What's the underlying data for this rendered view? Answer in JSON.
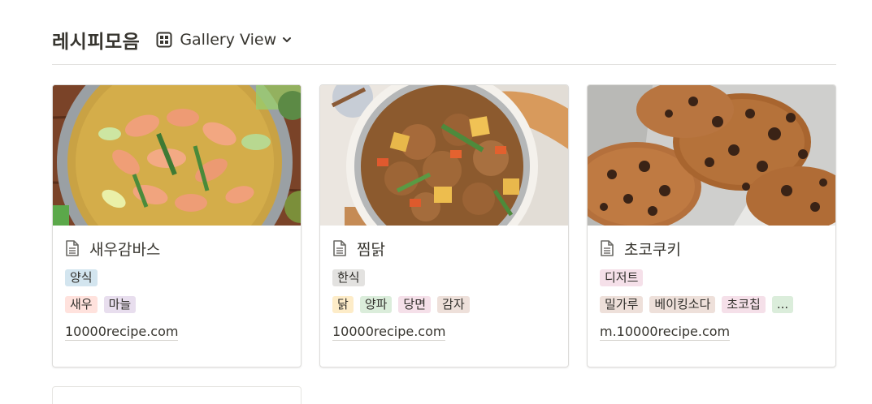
{
  "page": {
    "title": "레시피모음",
    "view_label": "Gallery View"
  },
  "colors": {
    "tag_blue": "#d3e5ef",
    "tag_red": "#ffe2dd",
    "tag_purple": "#e8deee",
    "tag_gray": "#e3e2e0",
    "tag_yellow": "#fdecc8",
    "tag_green": "#dbeddb",
    "tag_pink": "#f5e0e9",
    "tag_brown": "#eee0da"
  },
  "cards": [
    {
      "title": "새우감바스",
      "tags_row1": [
        "양식"
      ],
      "tags_row2": [
        "새우",
        "마늘"
      ],
      "url": "10000recipe.com"
    },
    {
      "title": "찜닭",
      "tags_row1": [
        "한식"
      ],
      "tags_row2": [
        "닭",
        "양파",
        "당면",
        "감자"
      ],
      "url": "10000recipe.com"
    },
    {
      "title": "초코쿠키",
      "tags_row1": [
        "디저트"
      ],
      "tags_row2": [
        "밀가루",
        "베이킹소다",
        "초코칩",
        "..."
      ],
      "url": "m.10000recipe.com"
    }
  ]
}
